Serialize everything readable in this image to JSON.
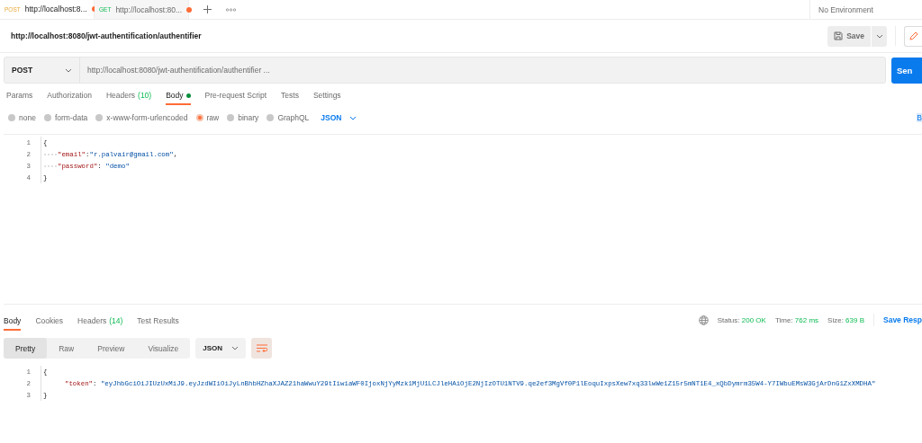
{
  "tabs": [
    {
      "method": "POST",
      "url": "http://localhost:8...",
      "unsaved": true,
      "selected": true
    },
    {
      "method": "GET",
      "url": "http://localhost:80...",
      "unsaved": true,
      "selected": false
    }
  ],
  "environment": "No Environment",
  "request_title": "http://localhost:8080/jwt-authentification/authentifier",
  "save_button": "Save",
  "request": {
    "method": "POST",
    "url": "http://localhost:8080/jwt-authentification/authentifier ...",
    "send_button": "Sen"
  },
  "request_tabs": [
    {
      "label": "Params",
      "selected": false
    },
    {
      "label": "Authorization",
      "selected": false
    },
    {
      "label": "Headers",
      "count": "(10)",
      "selected": false
    },
    {
      "label": "Body",
      "selected": true,
      "has_content": true
    },
    {
      "label": "Pre-request Script",
      "selected": false
    },
    {
      "label": "Tests",
      "selected": false
    },
    {
      "label": "Settings",
      "selected": false
    }
  ],
  "body_types": [
    {
      "label": "none",
      "selected": false
    },
    {
      "label": "form-data",
      "selected": false
    },
    {
      "label": "x-www-form-urlencoded",
      "selected": false
    },
    {
      "label": "raw",
      "selected": true
    },
    {
      "label": "binary",
      "selected": false
    },
    {
      "label": "GraphQL",
      "selected": false
    }
  ],
  "body_format": "JSON",
  "beautify_link": "B",
  "request_body": [
    {
      "number": "1",
      "indent": false,
      "tokens": [
        {
          "kind": "punct",
          "text": "{"
        }
      ]
    },
    {
      "number": "2",
      "indent": true,
      "tokens": [
        {
          "kind": "key",
          "text": "\"email\""
        },
        {
          "kind": "punct",
          "text": ":"
        },
        {
          "kind": "string",
          "text": "\"r.palvair@gmail.com\""
        },
        {
          "kind": "punct",
          "text": ","
        }
      ]
    },
    {
      "number": "3",
      "indent": true,
      "tokens": [
        {
          "kind": "key",
          "text": "\"password\""
        },
        {
          "kind": "punct",
          "text": ": "
        },
        {
          "kind": "string",
          "text": "\"demo\""
        }
      ]
    },
    {
      "number": "4",
      "indent": false,
      "tokens": [
        {
          "kind": "punct",
          "text": "}"
        }
      ]
    }
  ],
  "response_tabs": [
    {
      "label": "Body",
      "selected": true
    },
    {
      "label": "Cookies",
      "selected": false
    },
    {
      "label": "Headers",
      "count": "(14)",
      "selected": false
    },
    {
      "label": "Test Results",
      "selected": false
    }
  ],
  "status": [
    {
      "label": "Status:",
      "value": "200 OK"
    },
    {
      "label": "Time:",
      "value": "762 ms"
    },
    {
      "label": "Size:",
      "value": "639 B"
    }
  ],
  "save_response": "Save Resp",
  "view_modes": [
    {
      "label": "Pretty",
      "selected": true
    },
    {
      "label": "Raw",
      "selected": false
    },
    {
      "label": "Preview",
      "selected": false
    },
    {
      "label": "Visualize",
      "selected": false
    }
  ],
  "response_format": "JSON",
  "response_body": [
    {
      "number": "1",
      "indent": false,
      "tokens": [
        {
          "kind": "punct",
          "text": "{"
        }
      ]
    },
    {
      "number": "2",
      "indent": true,
      "tokens": [
        {
          "kind": "key",
          "text": "\"token\""
        },
        {
          "kind": "punct",
          "text": ": "
        },
        {
          "kind": "string",
          "text": "\"eyJhbGciOiJIUzUxMiJ9.eyJzdWIiOiJyLnBhbHZhaXJAZ21haWwuY29tIiwiaWF0IjoxNjYyMzk1MjU1LCJleHAiOjE2NjIzOTU1NTV9.qe2ef3MgVf0P1lEoquIxpsXew7xq33lwWe1Z15r5mNT1E4_xQbDymrm35W4-Y7IWbuEMsW3GjArDnG1ZxXMDHA\""
        }
      ]
    },
    {
      "number": "3",
      "indent": false,
      "tokens": [
        {
          "kind": "punct",
          "text": "}"
        }
      ]
    }
  ]
}
